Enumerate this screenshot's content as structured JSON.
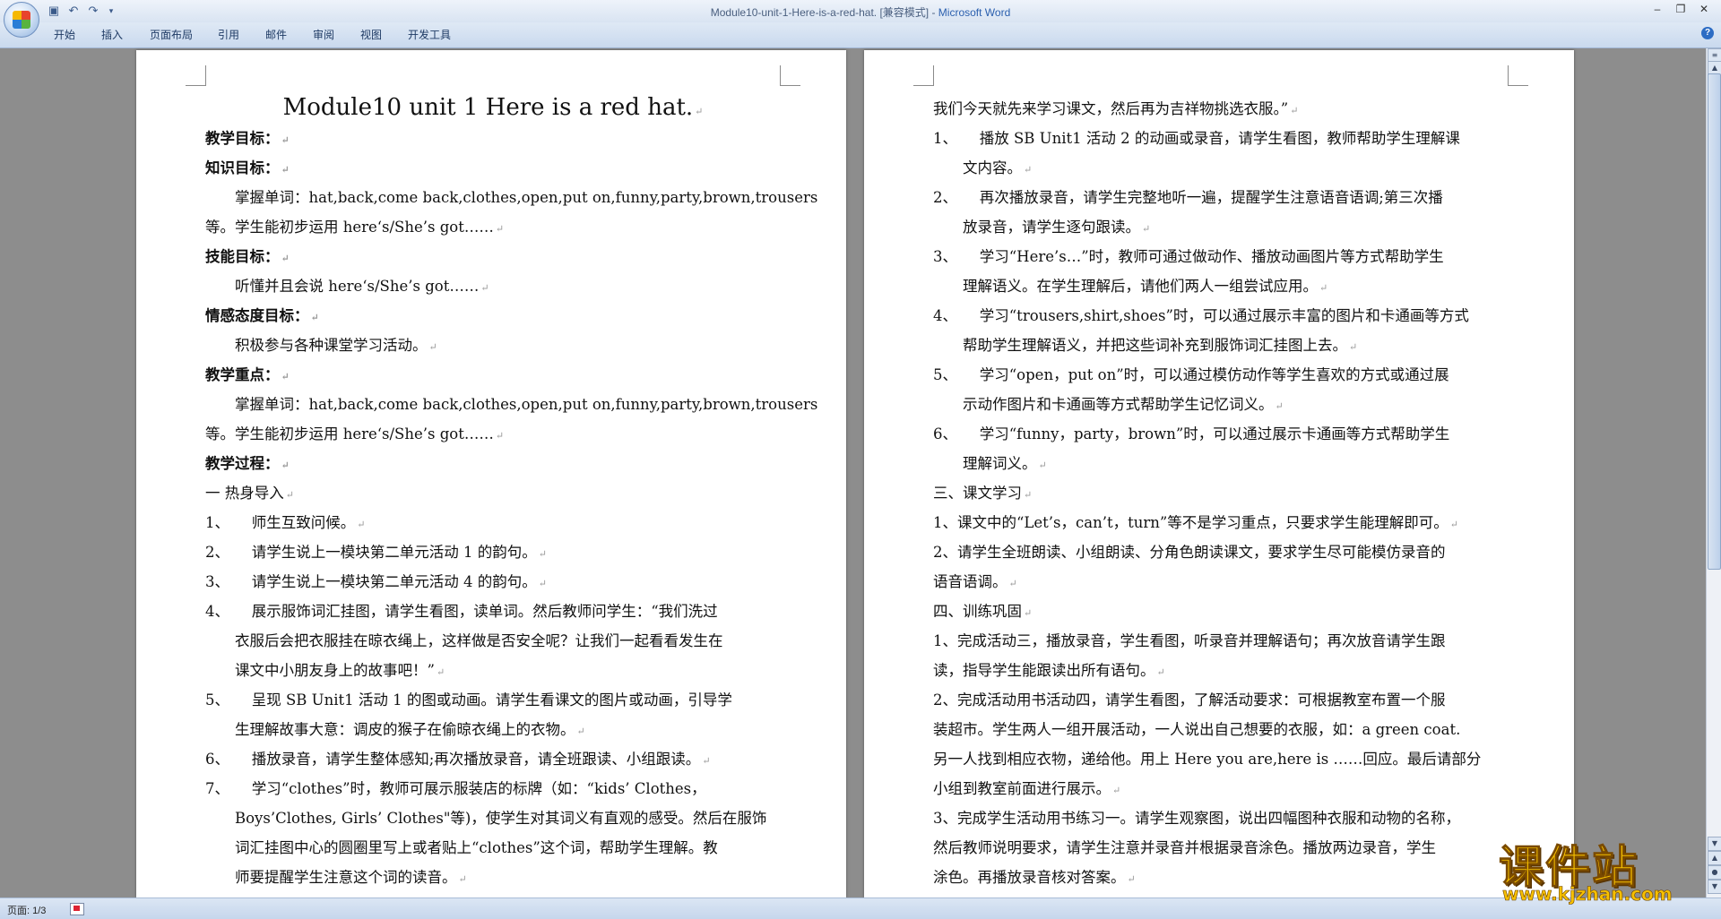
{
  "window": {
    "doc_name": "Module10-unit-1-Here-is-a-red-hat. [兼容模式] - ",
    "app_name": "Microsoft Word"
  },
  "ribbon": {
    "tabs": [
      "开始",
      "插入",
      "页面布局",
      "引用",
      "邮件",
      "审阅",
      "视图",
      "开发工具"
    ]
  },
  "status": {
    "page": "页面: 1/3"
  },
  "watermark": {
    "main": "课件站",
    "url": "www.kjzhan.com"
  },
  "left_page": {
    "title": "Module10 unit 1 Here is a red hat.",
    "lines": [
      "教学目标：",
      "知识目标：",
      "　　掌握单词：hat,back,come  back,clothes,open,put  on,funny,party,brown,trousers",
      "等。学生能初步运用 here‘s/She’s got……",
      "技能目标：",
      "　　听懂并且会说 here‘s/She’s got……",
      "情感态度目标：",
      "　　积极参与各种课堂学习活动。",
      "教学重点：",
      "　　掌握单词：hat,back,come  back,clothes,open,put  on,funny,party,brown,trousers",
      "等。学生能初步运用 here‘s/She’s got……",
      "教学过程：",
      "一  热身导入",
      "1、　　师生互致问候。",
      "2、　　请学生说上一模块第二单元活动 1 的韵句。",
      "3、　　请学生说上一模块第二单元活动 4 的韵句。",
      "4、　　展示服饰词汇挂图，请学生看图，读单词。然后教师问学生：“我们洗过",
      "　　衣服后会把衣服挂在晾衣绳上，这样做是否安全呢？让我们一起看看发生在",
      "　　课文中小朋友身上的故事吧！”",
      "5、　　呈现 SB Unit1 活动 1 的图或动画。请学生看课文的图片或动画，引导学",
      "　　生理解故事大意：调皮的猴子在偷晾衣绳上的衣物。",
      "6、　　播放录音，请学生整体感知;再次播放录音，请全班跟读、小组跟读。",
      "7、　　学习“clothes”时，教师可展示服装店的标牌（如：“kids’ Clothes，",
      "　　Boys’Clothes, Girls’ Clothes\"等)，使学生对其词义有直观的感受。然后在服饰",
      "　　词汇挂图中心的圆圈里写上或者贴上“clothes”这个词，帮助学生理解。教",
      "　　师要提醒学生注意这个词的读音。"
    ]
  },
  "right_page": {
    "lines": [
      "我们今天就先来学习课文，然后再为吉祥物挑选衣服。”",
      "1、　　播放 SB Unit1 活动 2 的动画或录音，请学生看图，教师帮助学生理解课",
      "　　文内容。",
      "2、　　再次播放录音，请学生完整地听一遍，提醒学生注意语音语调;第三次播",
      "　　放录音，请学生逐句跟读。",
      "3、　　学习“Here’s…”时，教师可通过做动作、播放动画图片等方式帮助学生",
      "　　理解语义。在学生理解后，请他们两人一组尝试应用。",
      "4、　　学习“trousers,shirt,shoes”时，可以通过展示丰富的图片和卡通画等方式",
      "　　帮助学生理解语义，并把这些词补充到服饰词汇挂图上去。",
      "5、　　学习“open，put on”时，可以通过模仿动作等学生喜欢的方式或通过展",
      "　　示动作图片和卡通画等方式帮助学生记忆词义。",
      "6、　　学习“funny，party，brown”时，可以通过展示卡通画等方式帮助学生",
      "　　理解词义。",
      "三、课文学习",
      "1、课文中的“Let’s，can’t，turn”等不是学习重点，只要求学生能理解即可。",
      "2、请学生全班朗读、小组朗读、分角色朗读课文，要求学生尽可能模仿录音的",
      "语音语调。",
      "四、训练巩固",
      "1、完成活动三，播放录音，学生看图，听录音并理解语句；再次放音请学生跟",
      "读，指导学生能跟读出所有语句。",
      "2、完成活动用书活动四，请学生看图，了解活动要求：可根据教室布置一个服",
      "装超市。学生两人一组开展活动，一人说出自己想要的衣服，如：a  green  coat.",
      "另一人找到相应衣物，递给他。用上 Here you are,here is  ……回应。最后请部分",
      "小组到教室前面进行展示。",
      "3、完成学生活动用书练习一。请学生观察图，说出四幅图种衣服和动物的名称，",
      "然后教师说明要求，请学生注意并录音并根据录音涂色。播放两边录音，学生",
      "涂色。再播放录音核对答案。"
    ]
  }
}
